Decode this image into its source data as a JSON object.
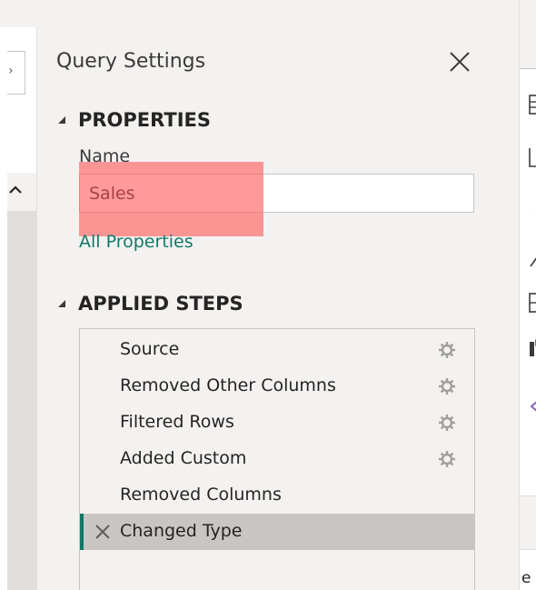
{
  "pane": {
    "title": "Query Settings",
    "close_icon": "close-icon"
  },
  "properties": {
    "heading": "PROPERTIES",
    "name_label": "Name",
    "name_value": "Sales",
    "all_properties_link": "All Properties"
  },
  "applied_steps": {
    "heading": "APPLIED STEPS",
    "steps": [
      {
        "label": "Source",
        "has_settings": true
      },
      {
        "label": "Removed Other Columns",
        "has_settings": true
      },
      {
        "label": "Filtered Rows",
        "has_settings": true
      },
      {
        "label": "Added Custom",
        "has_settings": true
      },
      {
        "label": "Removed Columns",
        "has_settings": false
      },
      {
        "label": "Changed Type",
        "has_settings": false,
        "selected": true
      }
    ]
  },
  "right_edge": {
    "partial_text": "e"
  },
  "colors": {
    "pane_bg": "#f3f2f1",
    "accent": "#117865",
    "highlight": "#ff5656",
    "selected_row": "#c8c6c4"
  }
}
